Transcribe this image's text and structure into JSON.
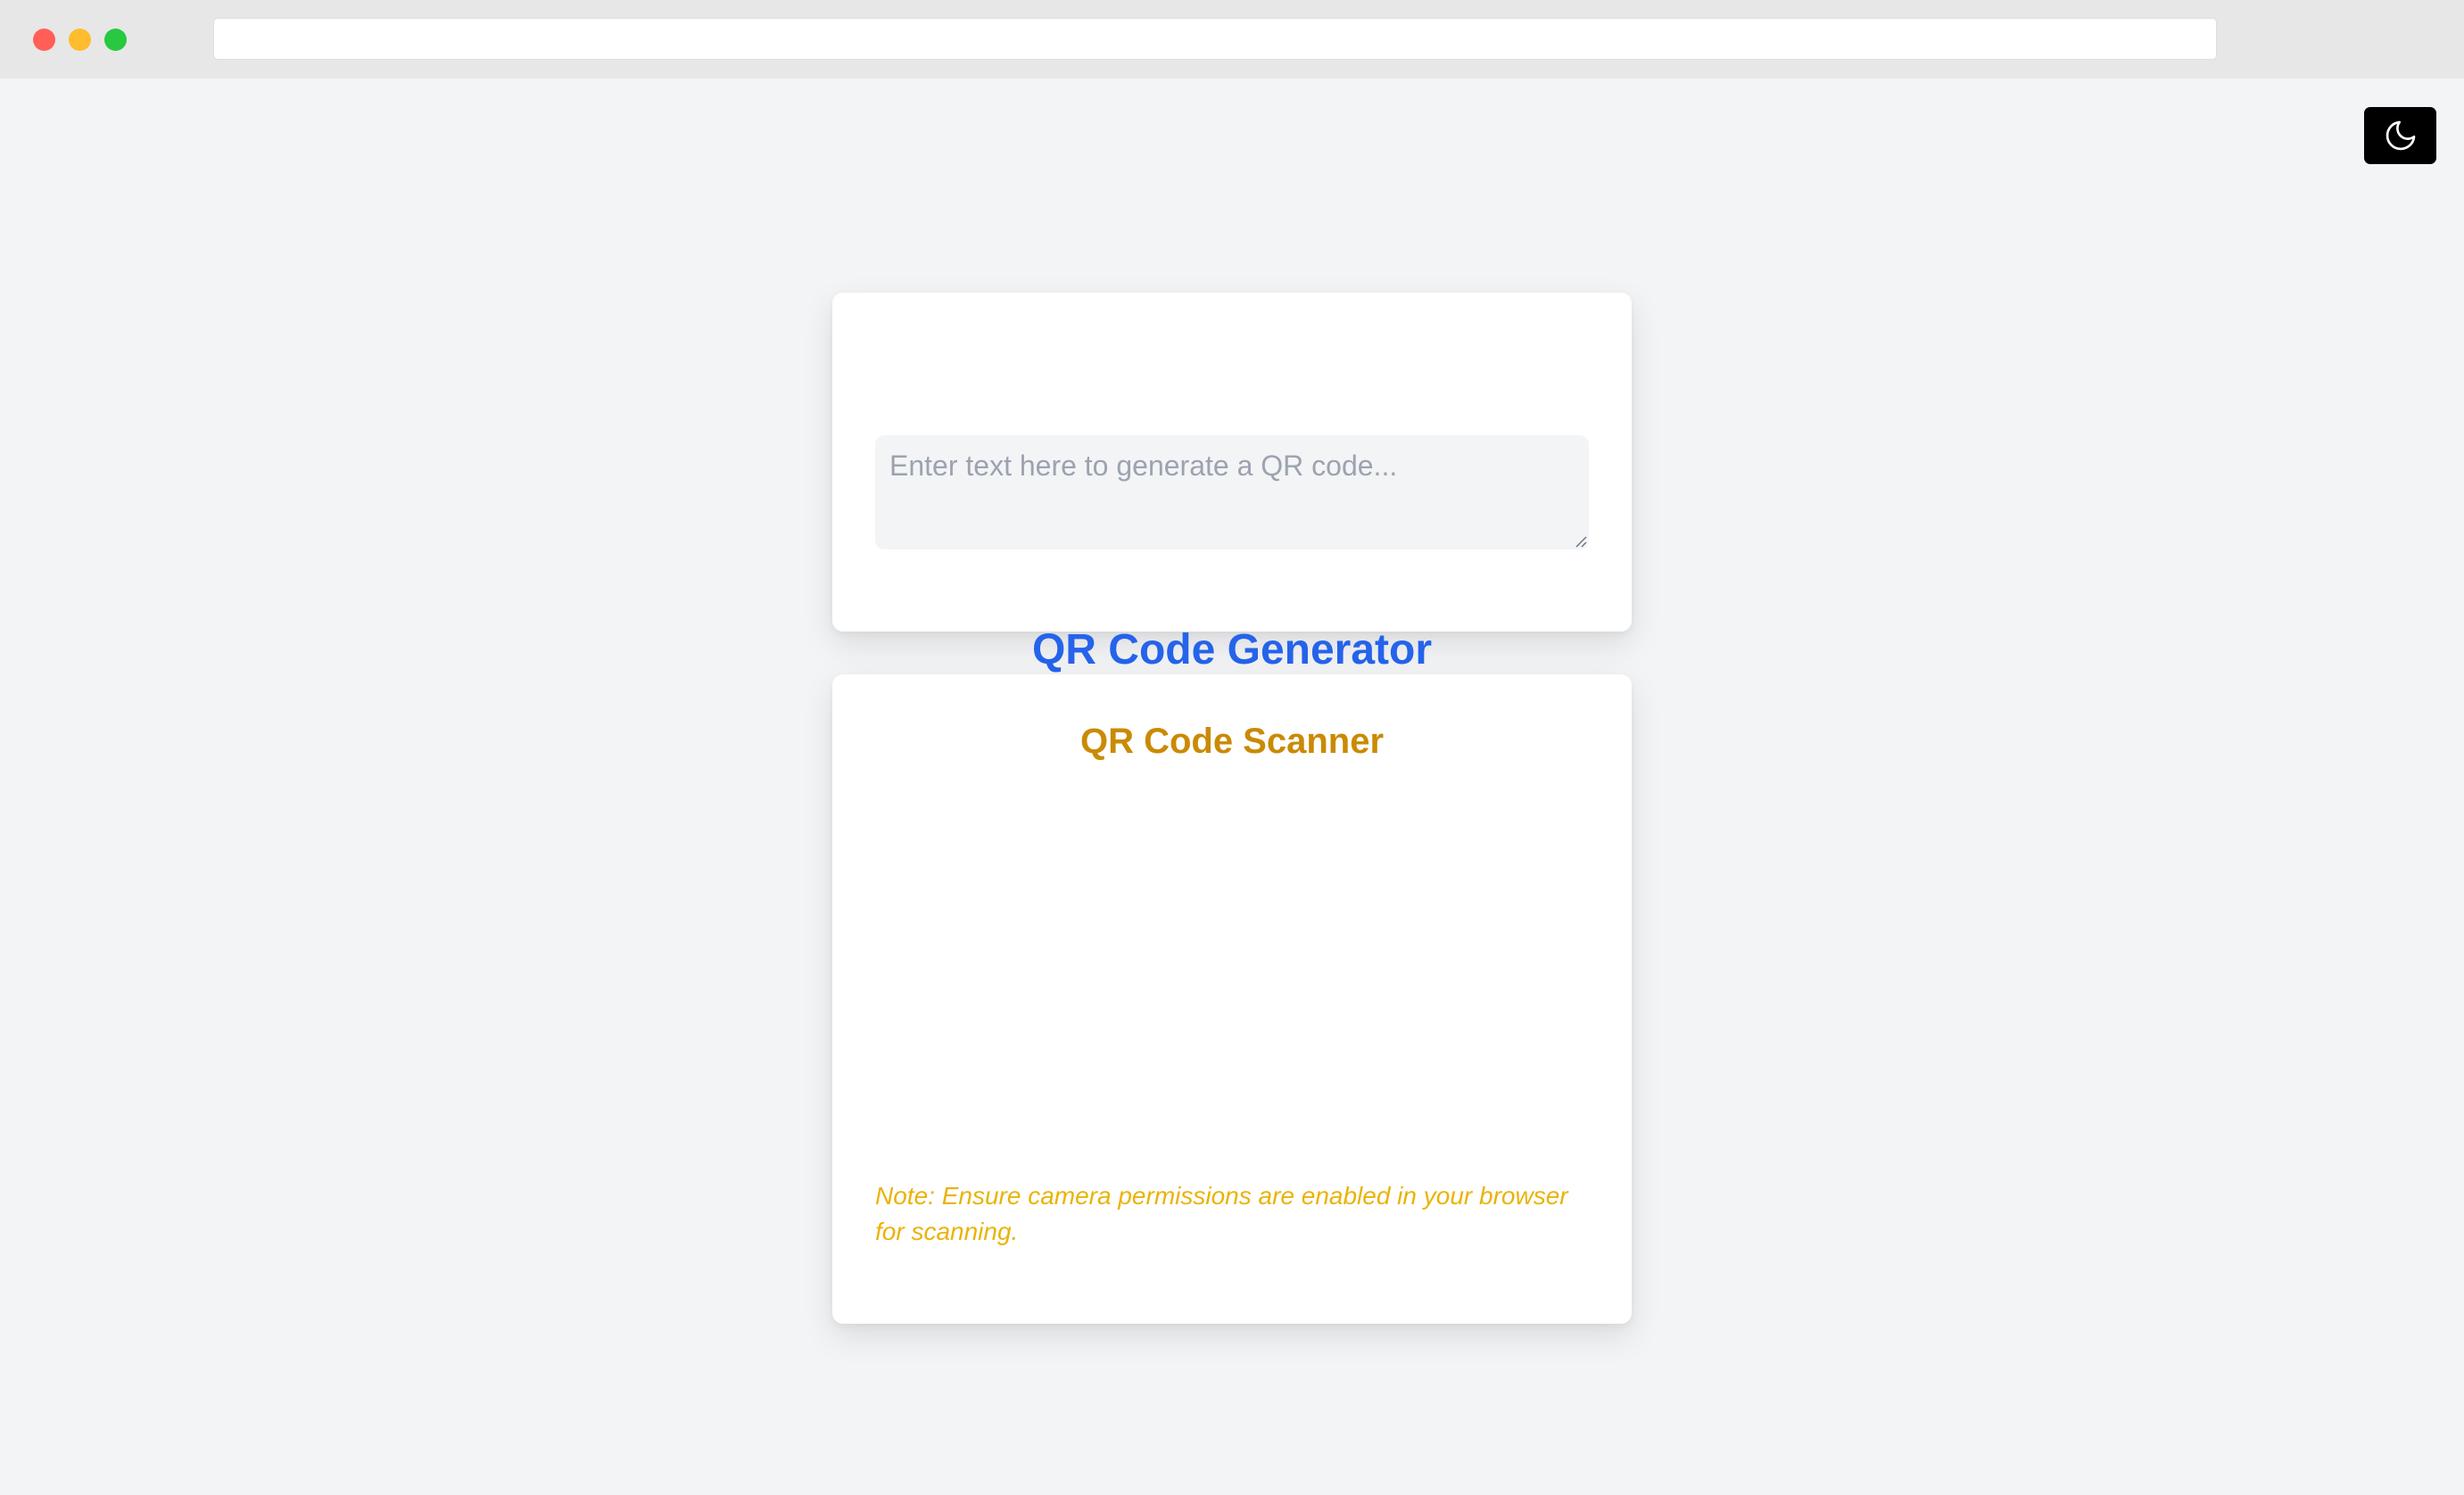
{
  "window": {
    "traffic_lights": {
      "close_color": "#ff5f57",
      "minimize_color": "#febc2e",
      "zoom_color": "#28c840"
    },
    "address_bar": {
      "value": ""
    }
  },
  "theme_toggle": {
    "icon": "moon-icon",
    "background": "#000000",
    "icon_color": "#ffffff"
  },
  "generator": {
    "title": "QR Code Generator",
    "title_color": "#2563eb",
    "input": {
      "value": "",
      "placeholder": "Enter text here to generate a QR code..."
    }
  },
  "scanner": {
    "title": "QR Code Scanner",
    "title_color": "#ca8a04",
    "note": "Note: Ensure camera permissions are enabled in your browser for scanning.",
    "note_color": "#eab308"
  }
}
